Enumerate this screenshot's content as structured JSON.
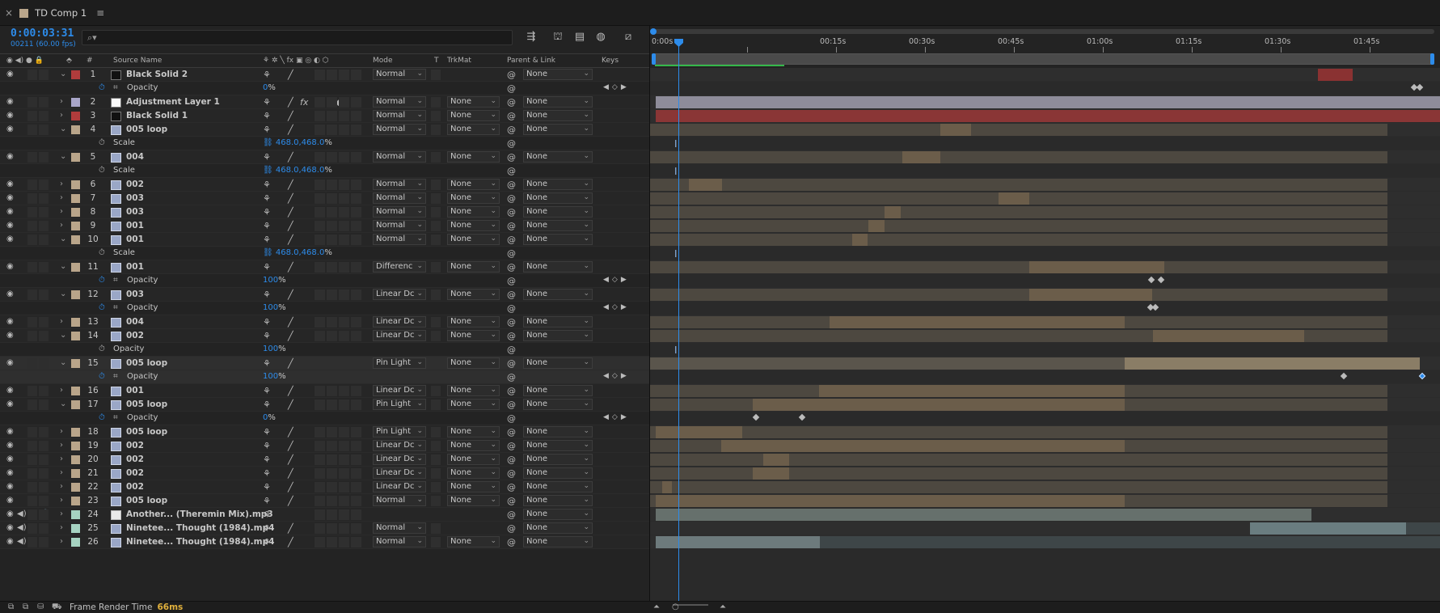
{
  "tab": {
    "close": "×",
    "title": "TD Comp 1",
    "menu": "≡"
  },
  "header": {
    "timecode": "0:00:03:31",
    "frames": "00211 (60.00 fps)",
    "search_icon": "⌕▾"
  },
  "columns": {
    "source_name": "Source Name",
    "number": "#",
    "mode": "Mode",
    "t": "T",
    "trkmat": "TrkMat",
    "parent": "Parent & Link",
    "keys": "Keys"
  },
  "ruler": [
    "0:00s",
    "00:15s",
    "00:30s",
    "00:45s",
    "01:00s",
    "01:15s",
    "01:30s",
    "01:45s"
  ],
  "rows": [
    {
      "type": "layer",
      "num": "1",
      "name": "Black Solid 2",
      "color": "#b03c3c",
      "thumb": "black",
      "open": true,
      "mode": "Normal",
      "trk": "",
      "par": "None"
    },
    {
      "type": "prop",
      "name": "Opacity",
      "stop": true,
      "graph": true,
      "value": "0",
      "unit": "%",
      "keys": true
    },
    {
      "type": "layer",
      "num": "2",
      "name": "Adjustment Layer 1",
      "color": "#a9a6c9",
      "thumb": "white",
      "open": false,
      "fx": true,
      "adj": true,
      "mode": "Normal",
      "trk": "None",
      "par": "None"
    },
    {
      "type": "layer",
      "num": "3",
      "name": "Black Solid 1",
      "color": "#b03c3c",
      "thumb": "black",
      "open": false,
      "mode": "Normal",
      "trk": "None",
      "par": "None"
    },
    {
      "type": "layer",
      "num": "4",
      "name": "005 loop",
      "color": "#b9a58a",
      "thumb": "film",
      "open": true,
      "mode": "Normal",
      "trk": "None",
      "par": "None"
    },
    {
      "type": "prop",
      "name": "Scale",
      "stop": false,
      "value": "468.0,468.0",
      "unit": "%",
      "link": true
    },
    {
      "type": "layer",
      "num": "5",
      "name": "004",
      "color": "#b9a58a",
      "thumb": "film",
      "open": true,
      "mode": "Normal",
      "trk": "None",
      "par": "None"
    },
    {
      "type": "prop",
      "name": "Scale",
      "stop": false,
      "value": "468.0,468.0",
      "unit": "%",
      "link": true
    },
    {
      "type": "layer",
      "num": "6",
      "name": "002",
      "color": "#b9a58a",
      "thumb": "film",
      "open": false,
      "mode": "Normal",
      "trk": "None",
      "par": "None"
    },
    {
      "type": "layer",
      "num": "7",
      "name": "003",
      "color": "#b9a58a",
      "thumb": "film",
      "open": false,
      "mode": "Normal",
      "trk": "None",
      "par": "None"
    },
    {
      "type": "layer",
      "num": "8",
      "name": "003",
      "color": "#b9a58a",
      "thumb": "film",
      "open": false,
      "mode": "Normal",
      "trk": "None",
      "par": "None"
    },
    {
      "type": "layer",
      "num": "9",
      "name": "001",
      "color": "#b9a58a",
      "thumb": "film",
      "open": false,
      "mode": "Normal",
      "trk": "None",
      "par": "None"
    },
    {
      "type": "layer",
      "num": "10",
      "name": "001",
      "color": "#b9a58a",
      "thumb": "film",
      "open": true,
      "mode": "Normal",
      "trk": "None",
      "par": "None"
    },
    {
      "type": "prop",
      "name": "Scale",
      "stop": false,
      "value": "468.0,468.0",
      "unit": "%",
      "link": true
    },
    {
      "type": "layer",
      "num": "11",
      "name": "001",
      "color": "#b9a58a",
      "thumb": "film",
      "open": true,
      "mode": "Differenc",
      "trk": "None",
      "par": "None"
    },
    {
      "type": "prop",
      "name": "Opacity",
      "stop": true,
      "graph": true,
      "value": "100",
      "unit": "%",
      "keys": true
    },
    {
      "type": "layer",
      "num": "12",
      "name": "003",
      "color": "#b9a58a",
      "thumb": "film",
      "open": true,
      "mode": "Linear Dc",
      "trk": "None",
      "par": "None"
    },
    {
      "type": "prop",
      "name": "Opacity",
      "stop": true,
      "graph": true,
      "value": "100",
      "unit": "%",
      "keys": true
    },
    {
      "type": "layer",
      "num": "13",
      "name": "004",
      "color": "#b9a58a",
      "thumb": "film",
      "open": false,
      "mode": "Linear Dc",
      "trk": "None",
      "par": "None"
    },
    {
      "type": "layer",
      "num": "14",
      "name": "002",
      "color": "#b9a58a",
      "thumb": "film",
      "open": true,
      "mode": "Linear Dc",
      "trk": "None",
      "par": "None"
    },
    {
      "type": "prop",
      "name": "Opacity",
      "stop": false,
      "value": "100",
      "unit": "%"
    },
    {
      "type": "layer",
      "num": "15",
      "name": "005 loop",
      "color": "#b9a58a",
      "thumb": "film",
      "open": true,
      "mode": "Pin Light",
      "trk": "None",
      "par": "None",
      "selected": true
    },
    {
      "type": "prop",
      "name": "Opacity",
      "stop": true,
      "graph": true,
      "value": "100",
      "unit": "%",
      "keys": true,
      "selected": true
    },
    {
      "type": "layer",
      "num": "16",
      "name": "001",
      "color": "#b9a58a",
      "thumb": "film",
      "open": false,
      "mode": "Linear Dc",
      "trk": "None",
      "par": "None"
    },
    {
      "type": "layer",
      "num": "17",
      "name": "005 loop",
      "color": "#b9a58a",
      "thumb": "film",
      "open": true,
      "mode": "Pin Light",
      "trk": "None",
      "par": "None"
    },
    {
      "type": "prop",
      "name": "Opacity",
      "stop": true,
      "graph": true,
      "value": "0",
      "unit": "%",
      "keys": true
    },
    {
      "type": "layer",
      "num": "18",
      "name": "005 loop",
      "color": "#b9a58a",
      "thumb": "film",
      "open": false,
      "mode": "Pin Light",
      "trk": "None",
      "par": "None"
    },
    {
      "type": "layer",
      "num": "19",
      "name": "002",
      "color": "#b9a58a",
      "thumb": "film",
      "open": false,
      "mode": "Linear Dc",
      "trk": "None",
      "par": "None"
    },
    {
      "type": "layer",
      "num": "20",
      "name": "002",
      "color": "#b9a58a",
      "thumb": "film",
      "open": false,
      "mode": "Linear Dc",
      "trk": "None",
      "par": "None"
    },
    {
      "type": "layer",
      "num": "21",
      "name": "002",
      "color": "#b9a58a",
      "thumb": "film",
      "open": false,
      "mode": "Linear Dc",
      "trk": "None",
      "par": "None"
    },
    {
      "type": "layer",
      "num": "22",
      "name": "002",
      "color": "#b9a58a",
      "thumb": "film",
      "open": false,
      "mode": "Linear Dc",
      "trk": "None",
      "par": "None"
    },
    {
      "type": "layer",
      "num": "23",
      "name": "005 loop",
      "color": "#b9a58a",
      "thumb": "film",
      "open": false,
      "mode": "Normal",
      "trk": "None",
      "par": "None"
    },
    {
      "type": "layer",
      "num": "24",
      "name": "Another... (Theremin Mix).mp3",
      "color": "#a6d3c1",
      "thumb": "audio",
      "open": false,
      "audio": true,
      "mode": "",
      "trk": "",
      "par": "None"
    },
    {
      "type": "layer",
      "num": "25",
      "name": "Ninetee... Thought (1984).mp4",
      "color": "#a6d3c1",
      "thumb": "film",
      "open": false,
      "mode": "Normal",
      "trk": "",
      "par": "None"
    },
    {
      "type": "layer",
      "num": "26",
      "name": "Ninetee... Thought (1984).mp4",
      "color": "#a6d3c1",
      "thumb": "film",
      "open": false,
      "mode": "Normal",
      "trk": "None",
      "par": "None"
    }
  ],
  "footer": {
    "label": "Frame Render Time",
    "value": "66ms"
  }
}
